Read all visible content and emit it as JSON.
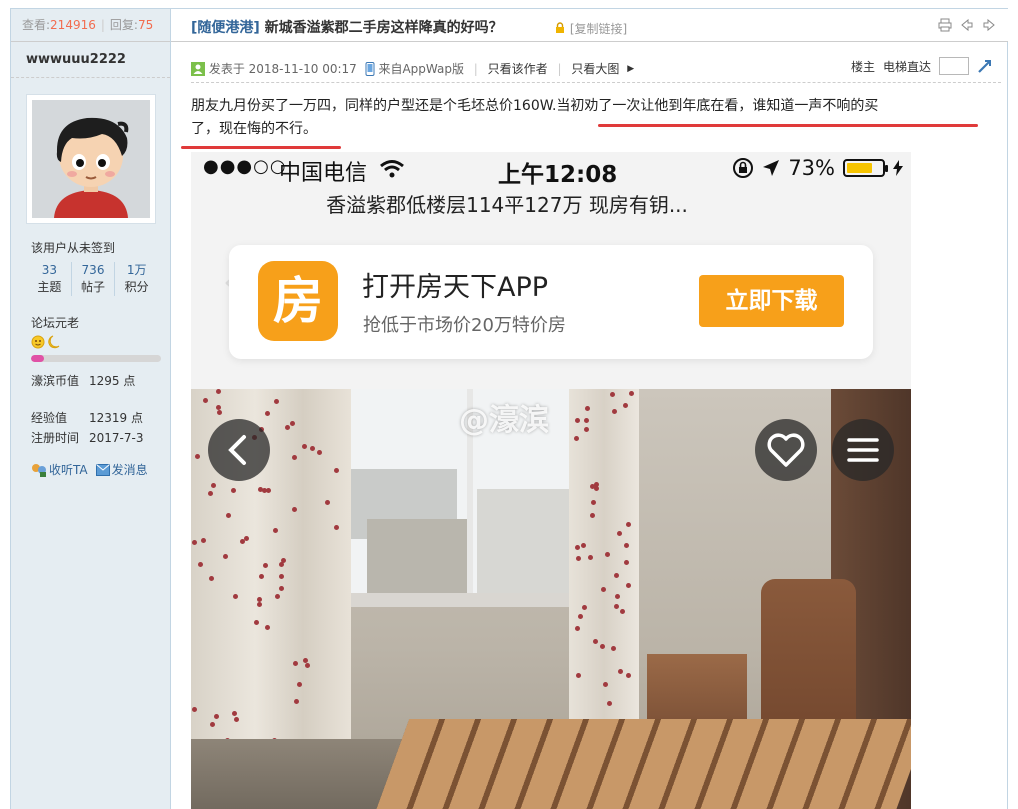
{
  "sidebar": {
    "views_label": "查看:",
    "views": "214916",
    "replies_label": "回复:",
    "replies": "75",
    "username": "wwwuuu2222",
    "sign_status": "该用户从未签到",
    "stats": [
      {
        "value": "33",
        "label": "主题"
      },
      {
        "value": "736",
        "label": "帖子"
      },
      {
        "value": "1万",
        "label": "积分"
      }
    ],
    "group": "论坛元老",
    "level_progress": 0.1,
    "coins_label": "濠滨币值",
    "coins": "1295 点",
    "exp_label": "经验值",
    "exp": "12319 点",
    "reg_label": "注册时间",
    "reg": "2017-7-3",
    "follow": "收听TA",
    "message": "发消息"
  },
  "post": {
    "category": "[随便港港]",
    "title": "新城香溢紫郡二手房这样降真的好吗？",
    "copy_link": "[复制链接]",
    "posted_at": "发表于 2018-11-10 00:17",
    "source": "来自AppWap版",
    "only_author": "只看该作者",
    "only_big": "只看大图",
    "floor": "楼主",
    "elevator": "电梯直达",
    "body_plain": "朋友九月份买了一万四，同样的户型还是个毛坯总价160W.",
    "body_underlined_1": "当初劝了一次让他到年底在看，谁知道一声不响的买",
    "body_underlined_2": "了，现在悔的不行。"
  },
  "embedded": {
    "signal": "●●●○○",
    "carrier": "中国电信",
    "time": "上午12:08",
    "battery": "73%",
    "battery_level": 0.73,
    "page_title": "香溢紫郡低楼层114平127万 现房有钥...",
    "app_icon_char": "房",
    "app_title": "打开房天下APP",
    "app_subtitle": "抢低于市场价20万特价房",
    "download_button": "立即下载",
    "watermark": "@濠滨"
  },
  "colors": {
    "link": "#336699",
    "accent": "#f26c4f",
    "underline": "#e03a3a",
    "app_orange": "#f7a01a"
  }
}
